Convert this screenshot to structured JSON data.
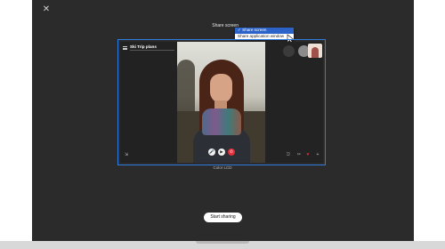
{
  "share": {
    "label": "Share screen",
    "options": [
      "✓ Share screen",
      "Share application window"
    ]
  },
  "chat": {
    "title": "Ski Trip plans"
  },
  "caption": "Color LCD",
  "start_button": "Start sharing",
  "colors": {
    "frame": "#2f7de1",
    "hangup": "#e0303a",
    "selected": "#2c63c9"
  },
  "icons": [
    "close-icon",
    "cursor-icon",
    "hamburger-icon",
    "mute-icon",
    "video-icon",
    "hangup-icon",
    "expand-icon",
    "link-icon",
    "crop-icon",
    "heart-icon",
    "plus-icon"
  ]
}
